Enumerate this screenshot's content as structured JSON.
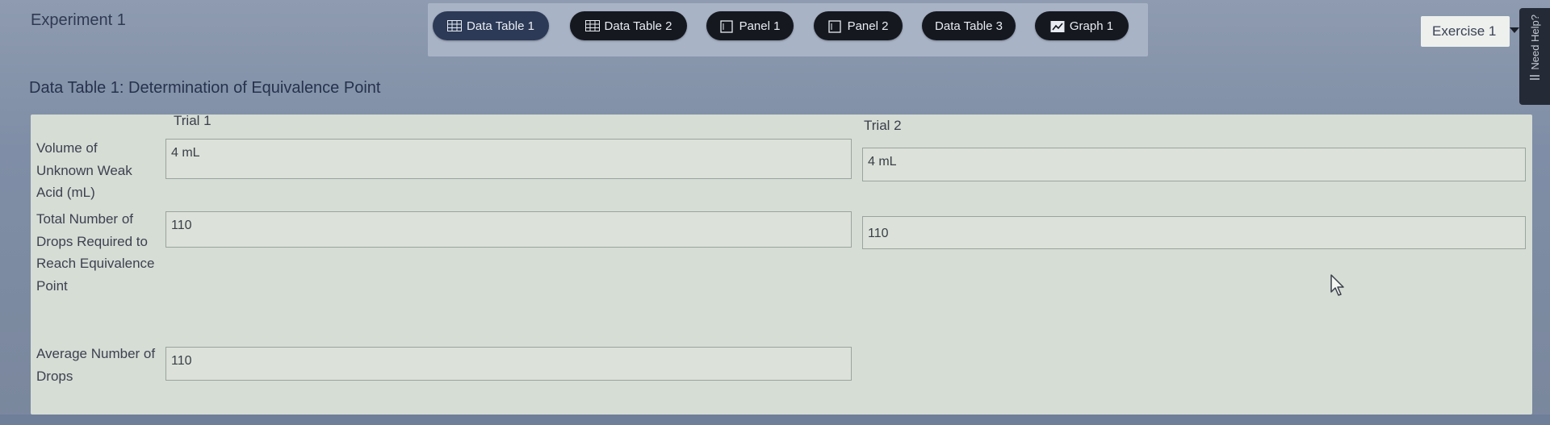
{
  "header": {
    "experiment_title": "Experiment 1",
    "exercise_select": "Exercise 1",
    "help_label": "Need Help?"
  },
  "tabs": [
    {
      "label": "Data Table 1",
      "icon": "table-icon",
      "active": true
    },
    {
      "label": "Data Table 2",
      "icon": "table-icon",
      "active": false
    },
    {
      "label": "Panel 1",
      "icon": "panel-icon",
      "active": false
    },
    {
      "label": "Panel 2",
      "icon": "panel-icon",
      "active": false
    },
    {
      "label": "Data Table 3",
      "icon": "",
      "active": false
    },
    {
      "label": "Graph 1",
      "icon": "graph-icon",
      "active": false
    }
  ],
  "data_table": {
    "title": "Data Table 1: Determination of Equivalence Point",
    "columns": [
      "Trial 1",
      "Trial 2"
    ],
    "rows": [
      {
        "label": "Volume of Unknown Weak Acid (mL)",
        "trial1": "4 mL",
        "trial2": "4 mL"
      },
      {
        "label": "Total Number of Drops Required to Reach Equivalence Point",
        "trial1": "110",
        "trial2": "110"
      },
      {
        "label": "Average Number of Drops",
        "value": "110"
      }
    ]
  }
}
